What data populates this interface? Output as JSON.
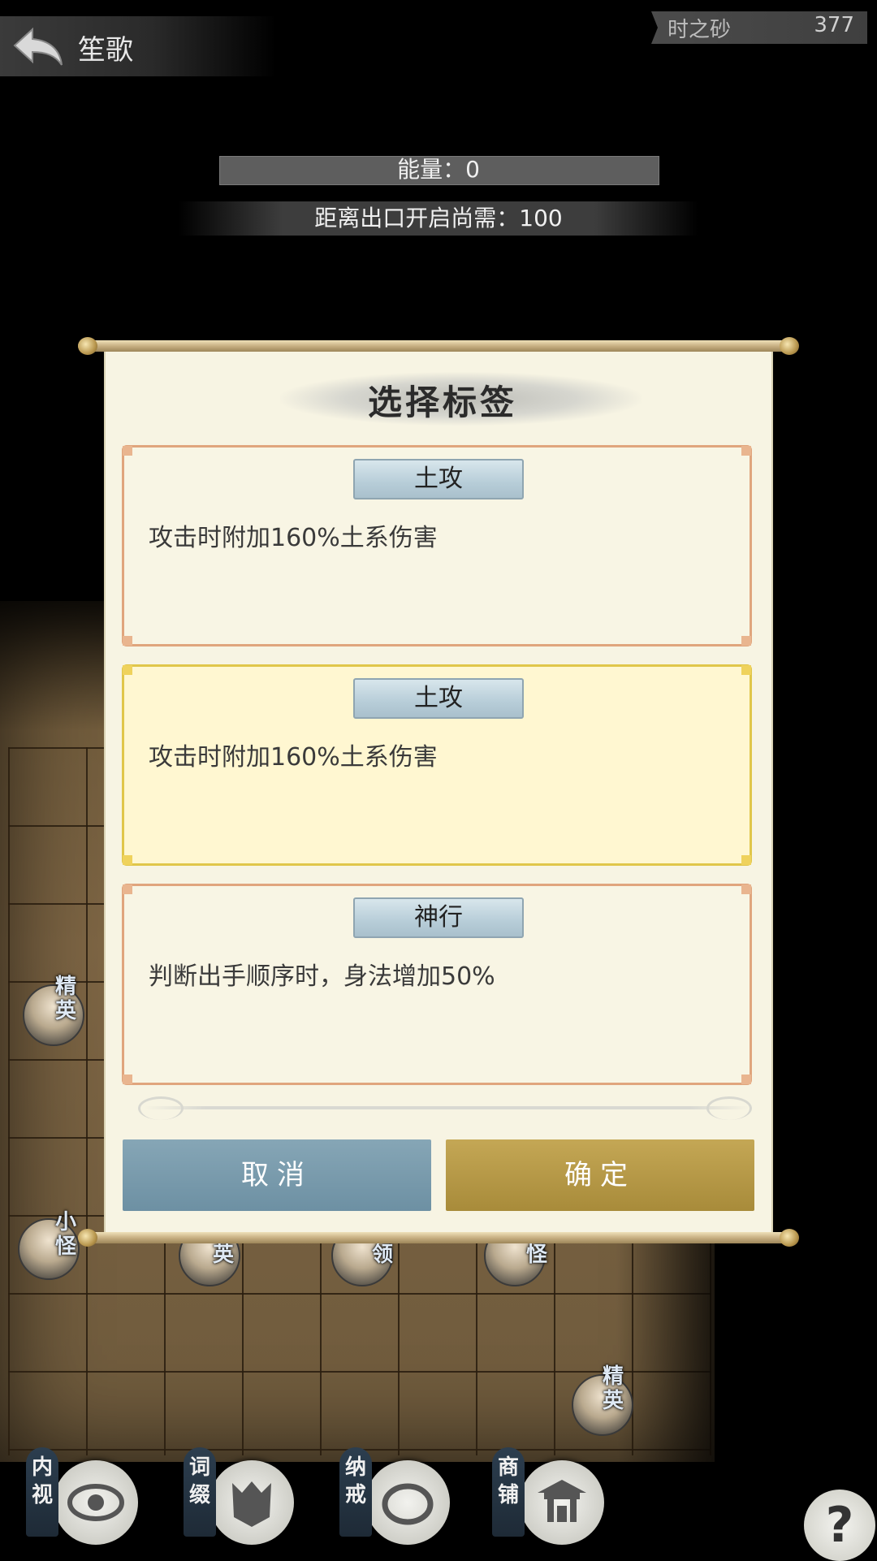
{
  "header": {
    "player_name": "笙歌",
    "currency_label": "时之砂",
    "currency_value": "377",
    "energy_text": "能量：0",
    "exit_text": "距离出口开启尚需：100"
  },
  "dialog": {
    "title": "选择标签",
    "options": [
      {
        "name": "土攻",
        "desc": "攻击时附加160%土系伤害",
        "selected": false
      },
      {
        "name": "土攻",
        "desc": "攻击时附加160%土系伤害",
        "selected": true
      },
      {
        "name": "神行",
        "desc": "判断出手顺序时，身法增加50%",
        "selected": false
      }
    ],
    "cancel_label": "取消",
    "confirm_label": "确定"
  },
  "board_pieces": [
    {
      "tag": "精英"
    },
    {
      "tag": "小怪"
    },
    {
      "tag": "英"
    },
    {
      "tag": "领"
    },
    {
      "tag": "怪"
    },
    {
      "tag": "精英"
    }
  ],
  "menu": {
    "items": [
      {
        "label": "内视",
        "icon": "eye-icon"
      },
      {
        "label": "词缀",
        "icon": "mask-icon"
      },
      {
        "label": "纳戒",
        "icon": "ring-icon"
      },
      {
        "label": "商铺",
        "icon": "shop-icon"
      }
    ],
    "help_label": "?"
  }
}
